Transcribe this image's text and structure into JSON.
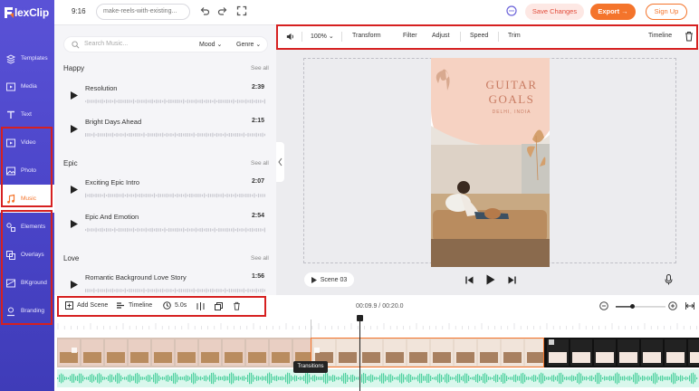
{
  "app": {
    "logo_text": "lexClip"
  },
  "topbar": {
    "duration": "9:16",
    "project_name": "make-reels-with-existing...",
    "save_label": "Save Changes",
    "export_label": "Export →",
    "signup_label": "Sign Up"
  },
  "sidebar": {
    "items": [
      {
        "label": "Templates",
        "icon": "templates-icon",
        "active": false
      },
      {
        "label": "Media",
        "icon": "media-icon",
        "active": false
      },
      {
        "label": "Text",
        "icon": "text-icon",
        "active": false
      },
      {
        "label": "Video",
        "icon": "video-icon",
        "active": false
      },
      {
        "label": "Photo",
        "icon": "photo-icon",
        "active": false
      },
      {
        "label": "Music",
        "icon": "music-icon",
        "active": true
      },
      {
        "label": "Elements",
        "icon": "elements-icon",
        "active": false
      },
      {
        "label": "Overlays",
        "icon": "overlays-icon",
        "active": false
      },
      {
        "label": "BKground",
        "icon": "background-icon",
        "active": false
      },
      {
        "label": "Branding",
        "icon": "branding-icon",
        "active": false
      }
    ]
  },
  "music": {
    "search_placeholder": "Search Music...",
    "mood_label": "Mood",
    "genre_label": "Genre",
    "see_all": "See all",
    "sections": [
      {
        "title": "Happy",
        "tracks": [
          {
            "name": "Resolution",
            "duration": "2:39"
          },
          {
            "name": "Bright Days Ahead",
            "duration": "2:15"
          }
        ]
      },
      {
        "title": "Epic",
        "tracks": [
          {
            "name": "Exciting Epic Intro",
            "duration": "2:07"
          },
          {
            "name": "Epic And Emotion",
            "duration": "2:54"
          }
        ]
      },
      {
        "title": "Love",
        "tracks": [
          {
            "name": "Romantic Background Love Story",
            "duration": "1:56"
          }
        ]
      }
    ]
  },
  "scene_toolbar": {
    "add_scene": "Add Scene",
    "timeline": "Timeline",
    "duration": "5.0s"
  },
  "edit_toolbar": {
    "volume": "100%",
    "transform": "Transform",
    "filter": "Filter",
    "adjust": "Adjust",
    "speed": "Speed",
    "trim": "Trim",
    "timeline": "Timeline"
  },
  "poster": {
    "title_line1": "GUITAR",
    "title_line2": "GOALS",
    "subtitle": "DELHI, INDIA"
  },
  "player": {
    "scene_label": "Scene 03",
    "time_display": "00:09.9 / 00:20.0"
  },
  "timeline": {
    "tooltip": "Transitions",
    "zoom_fraction": 0.33
  },
  "colors": {
    "accent": "#f4742b",
    "rail": "#4a44c8",
    "highlight_box": "#d62020",
    "audio_wave": "#4fd1a0"
  }
}
